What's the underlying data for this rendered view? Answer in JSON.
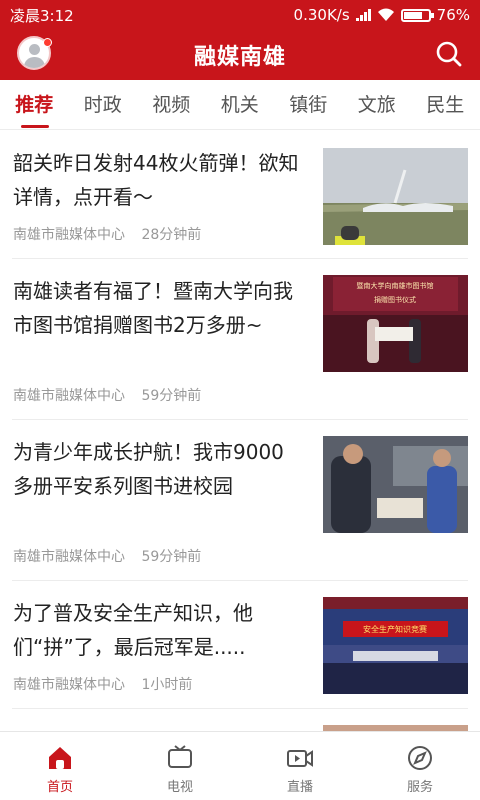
{
  "status_bar": {
    "time": "凌晨3:12",
    "speed": "0.30K/s",
    "battery": "76%",
    "battery_level": 0.76
  },
  "header": {
    "title": "融媒南雄"
  },
  "tabs": [
    "推荐",
    "时政",
    "视频",
    "机关",
    "镇街",
    "文旅",
    "民生"
  ],
  "articles": [
    {
      "title": "韶关昨日发射44枚火箭弹！欲知详情，点开看～",
      "source": "南雄市融媒体中心",
      "time": "28分钟前",
      "thumb_icon": "rocket-launch-photo"
    },
    {
      "title": "南雄读者有福了！暨南大学向我市图书馆捐赠图书2万多册~",
      "source": "南雄市融媒体中心",
      "time": "59分钟前",
      "thumb_icon": "donation-ceremony-photo",
      "thumb_text": [
        "暨南大学向南雄市图书馆",
        "捐赠图书仪式"
      ]
    },
    {
      "title": "为青少年成长护航！我市9000多册平安系列图书进校园",
      "source": "南雄市融媒体中心",
      "time": "59分钟前",
      "thumb_icon": "book-handover-photo"
    },
    {
      "title": "为了普及安全生产知识，他们“拼”了，最后冠军是.....",
      "source": "南雄市融媒体中心",
      "time": "1小时前",
      "thumb_icon": "safety-contest-photo",
      "thumb_text": [
        "安全生产知识竞赛"
      ]
    }
  ],
  "bottom_nav": [
    {
      "label": "首页",
      "icon": "home-icon",
      "active": true
    },
    {
      "label": "电视",
      "icon": "tv-icon",
      "active": false
    },
    {
      "label": "直播",
      "icon": "live-icon",
      "active": false
    },
    {
      "label": "服务",
      "icon": "compass-icon",
      "active": false
    }
  ],
  "colors": {
    "brand": "#c8151b",
    "text": "#222222",
    "meta": "#999999"
  }
}
